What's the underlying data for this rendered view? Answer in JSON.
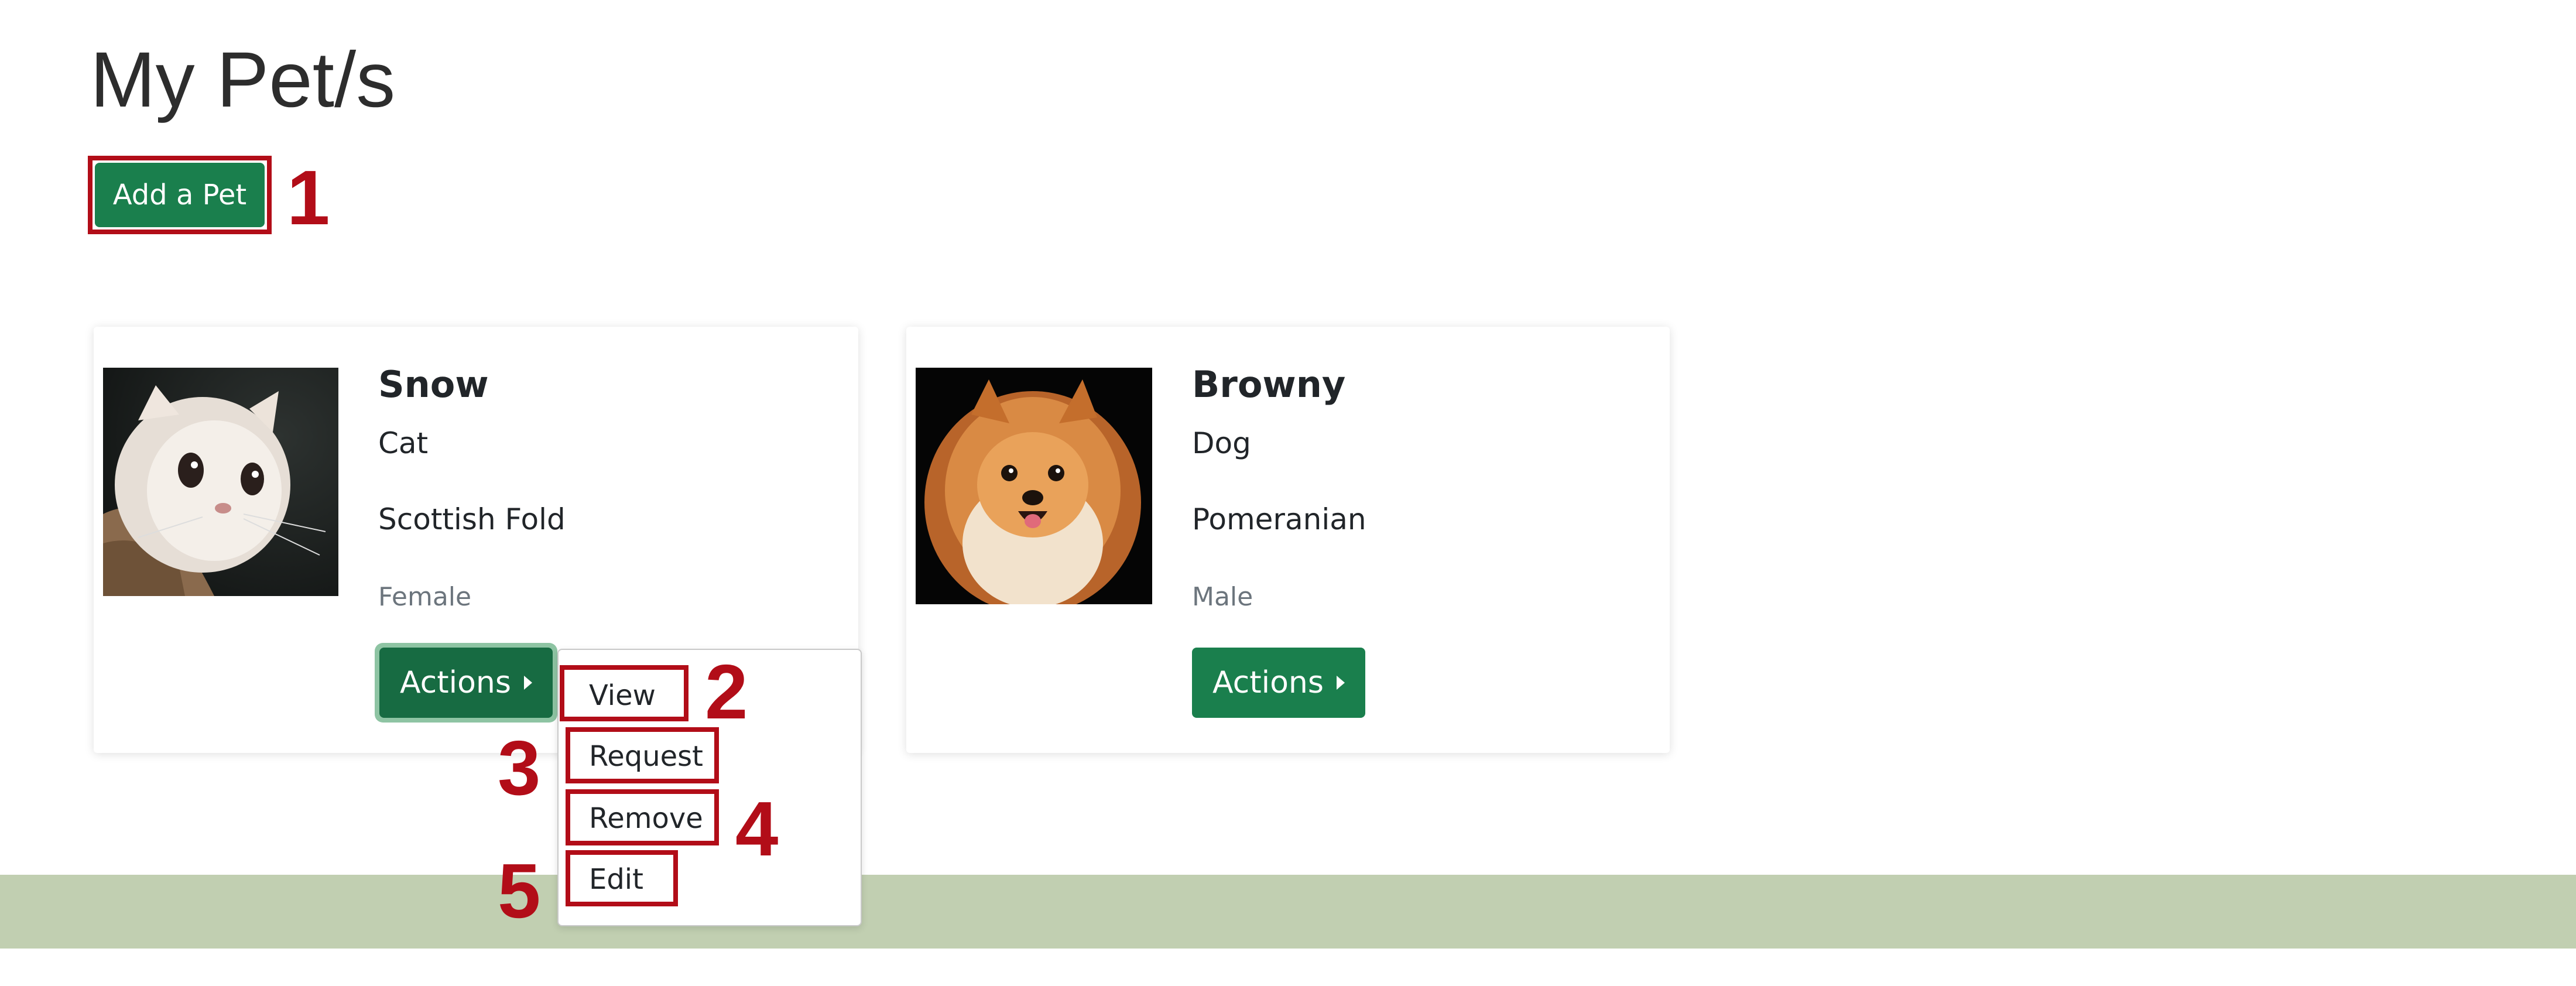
{
  "page": {
    "title": "My Pet/s",
    "add_button": "Add a Pet"
  },
  "pets": [
    {
      "name": "Snow",
      "type": "Cat",
      "breed": "Scottish Fold",
      "gender": "Female",
      "actions_label": "Actions"
    },
    {
      "name": "Browny",
      "type": "Dog",
      "breed": "Pomeranian",
      "gender": "Male",
      "actions_label": "Actions"
    }
  ],
  "actions_menu": {
    "items": [
      "View",
      "Request",
      "Remove",
      "Edit"
    ]
  },
  "callouts": [
    "1",
    "2",
    "3",
    "4",
    "5"
  ],
  "colors": {
    "primary_green": "#1a7f4d",
    "annotation_red": "#b20d18",
    "footer_band": "#c1cfb1",
    "muted_text": "#6c757d"
  },
  "icons": {
    "actions_caret": "caret-right-icon"
  }
}
